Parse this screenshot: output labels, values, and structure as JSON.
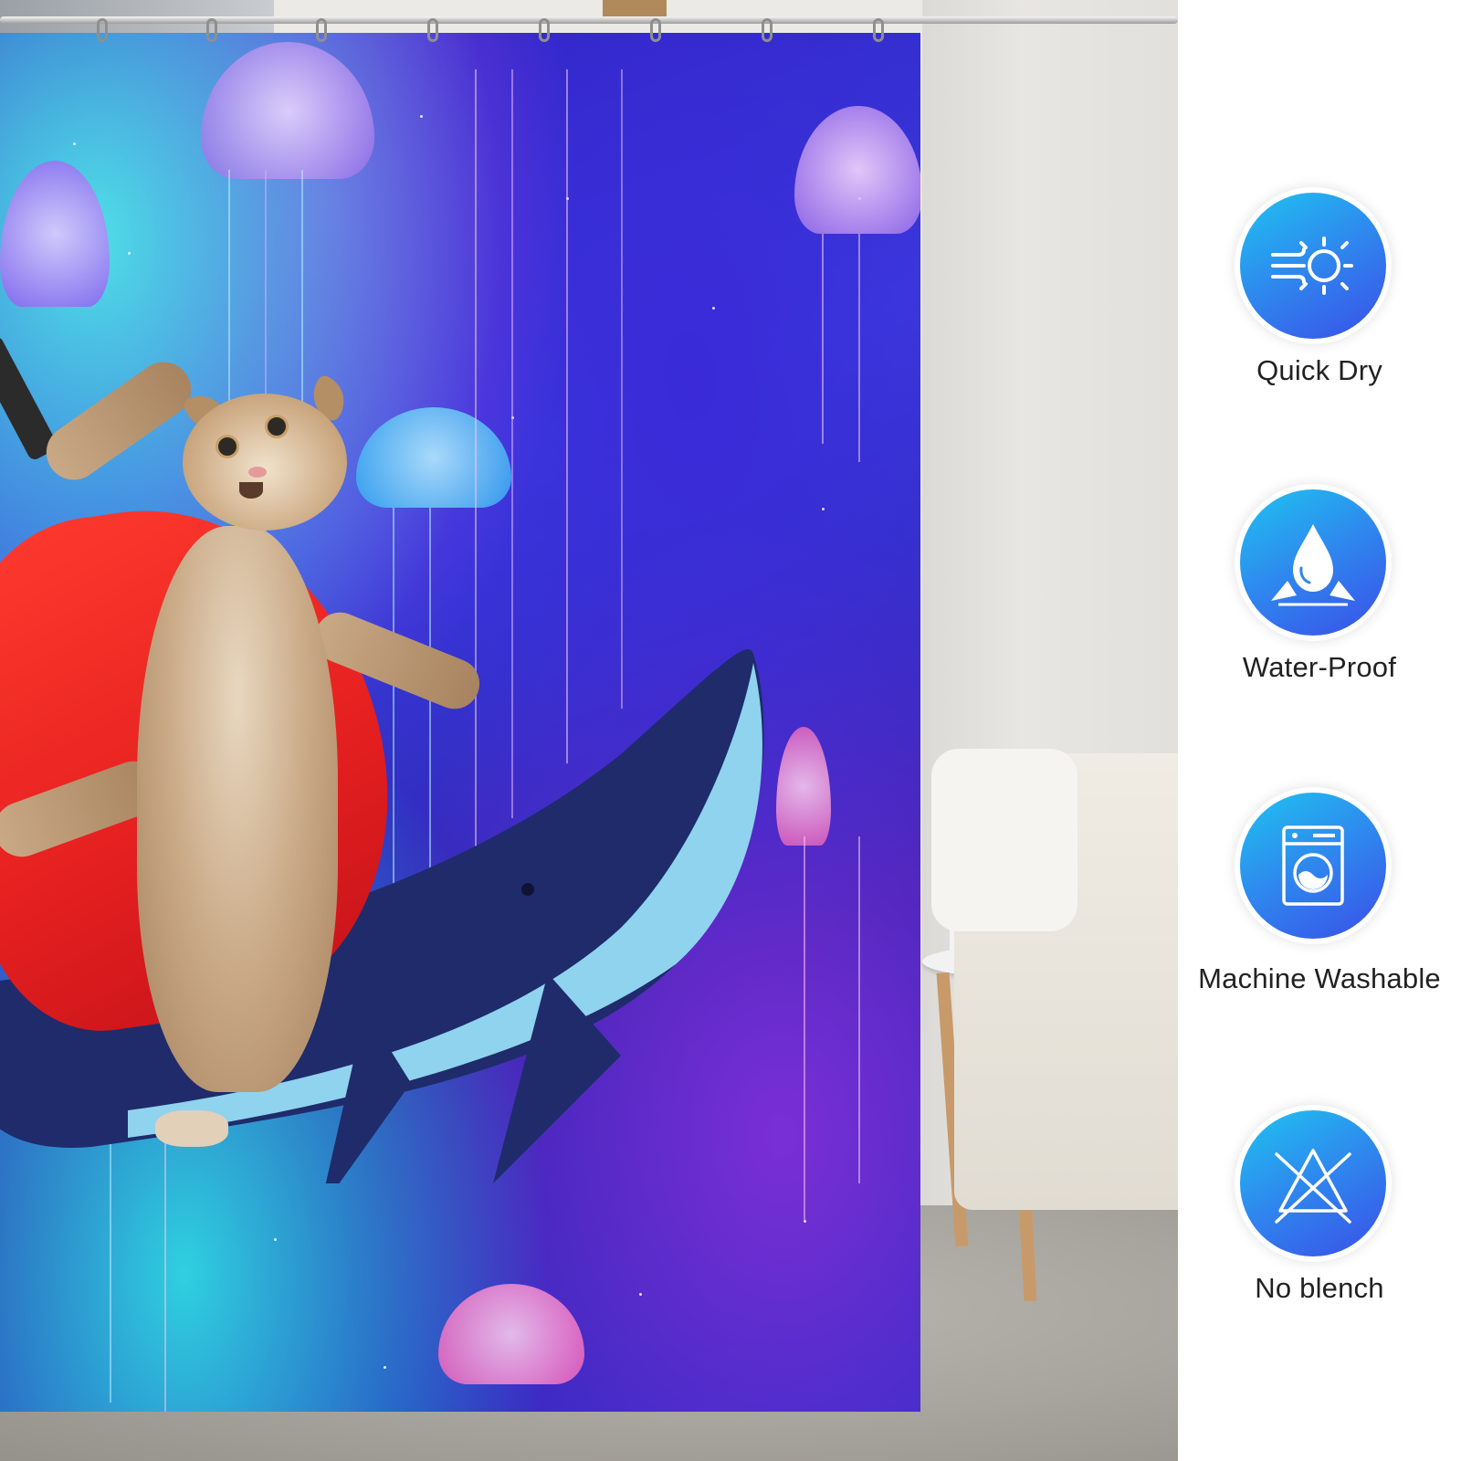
{
  "colors": {
    "badge_gradient_start": "#1fc4f0",
    "badge_gradient_end": "#3a4fe8",
    "label_text": "#222222",
    "cape_red": "#e41f1f",
    "whale_navy": "#1f2b6b",
    "whale_belly": "#8fd3ee"
  },
  "features": [
    {
      "label": "Quick Dry",
      "icon": "wind-sun-icon"
    },
    {
      "label": "Water-Proof",
      "icon": "water-drop-icon"
    },
    {
      "label": "Machine Washable",
      "icon": "washing-machine-icon"
    },
    {
      "label": "No blench",
      "icon": "no-bleach-icon"
    }
  ]
}
